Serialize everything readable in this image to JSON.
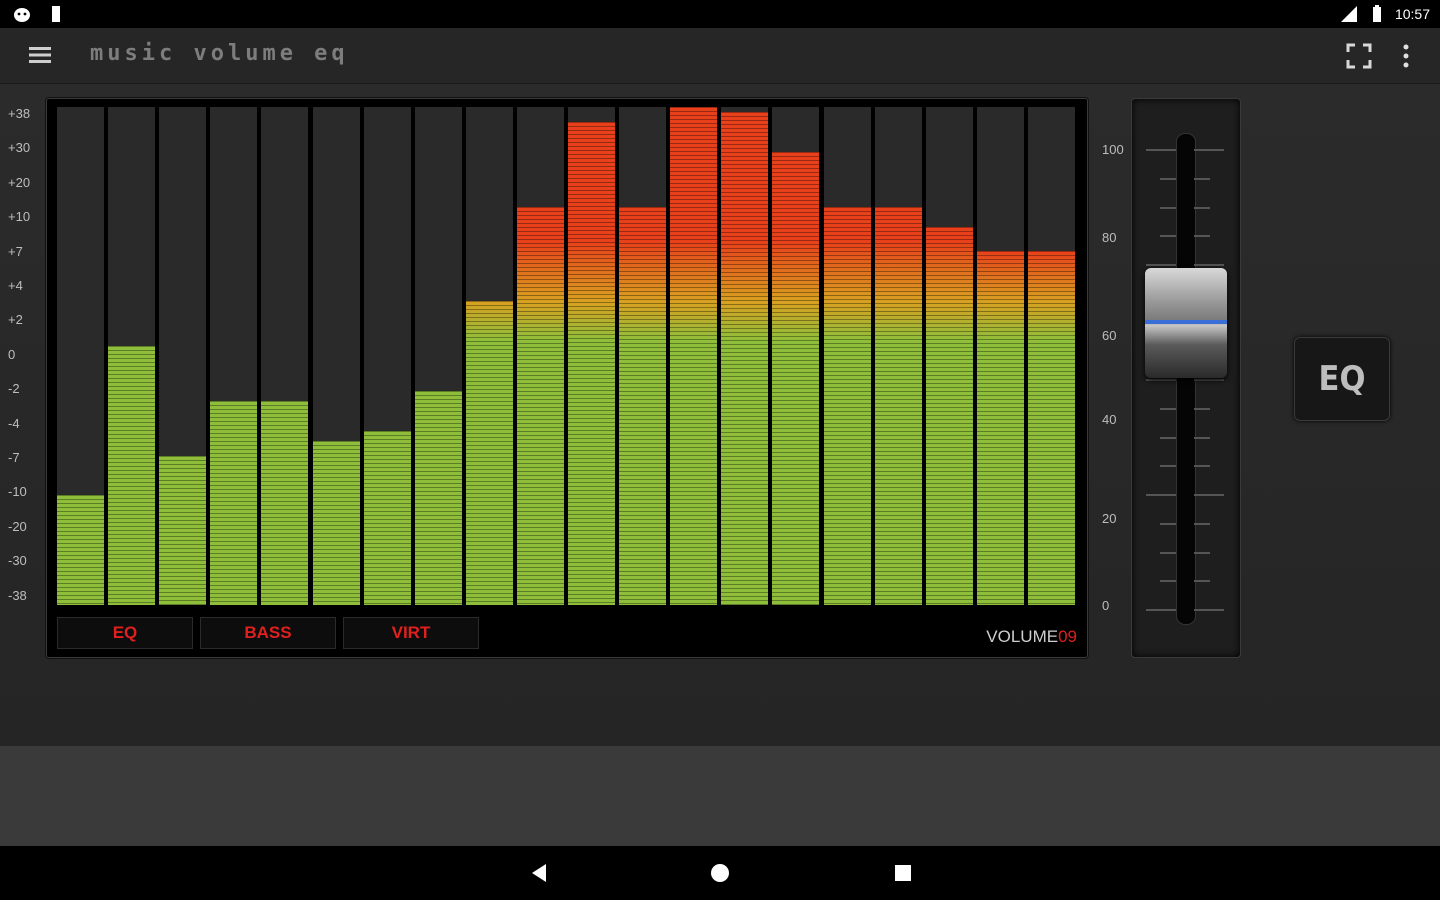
{
  "status_bar": {
    "time": "10:57",
    "left_icons": [
      "android-debug-icon",
      "sim-card-icon"
    ],
    "right_icons": [
      "signal-icon",
      "battery-icon"
    ]
  },
  "app_bar": {
    "title": "MUSIC VOLUME EQ",
    "icons": [
      "hamburger-menu-icon",
      "fullscreen-icon",
      "more-vert-icon"
    ]
  },
  "db_labels": [
    "+38",
    "+30",
    "+20",
    "+10",
    "+7",
    "+4",
    "+2",
    "0",
    "-2",
    "-4",
    "-7",
    "-10",
    "-20",
    "-30",
    "-38"
  ],
  "chart_data": {
    "type": "bar",
    "title": "",
    "values": [
      0.22,
      0.52,
      0.3,
      0.41,
      0.41,
      0.33,
      0.35,
      0.43,
      0.61,
      0.8,
      0.97,
      0.8,
      1.0,
      0.99,
      0.91,
      0.8,
      0.8,
      0.76,
      0.71,
      0.71
    ],
    "colors": {
      "low": "#8fbf3a",
      "mid": "#d9a020",
      "high": "#e8401a",
      "empty": "#2a2a2a"
    }
  },
  "tabs": [
    {
      "label": "EQ"
    },
    {
      "label": "BASS"
    },
    {
      "label": "VIRT"
    }
  ],
  "volume": {
    "label": "VOLUME",
    "value": "09"
  },
  "slider": {
    "labels": [
      "100",
      "80",
      "60",
      "40",
      "20",
      "0"
    ],
    "level": 62
  },
  "eq_button": {
    "label": "EQ"
  },
  "colors": {
    "accent_red": "#e0201e",
    "thumb_line": "#3b6fd8"
  }
}
